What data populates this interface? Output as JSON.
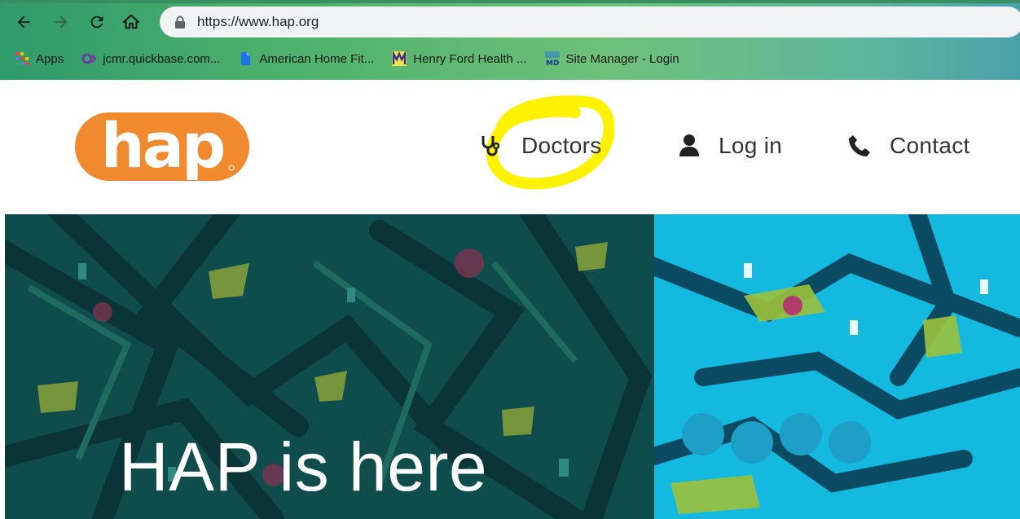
{
  "browser": {
    "url": "https://www.hap.org",
    "bookmarks": [
      {
        "label": "Apps",
        "icon": "apps-grid-icon"
      },
      {
        "label": "jcmr.quickbase.com...",
        "icon": "quickbase-icon"
      },
      {
        "label": "American Home Fit...",
        "icon": "bookmark-doc-icon"
      },
      {
        "label": "Henry Ford Health ...",
        "icon": "henry-ford-icon"
      },
      {
        "label": "Site Manager - Login",
        "icon": "md-icon"
      }
    ]
  },
  "site": {
    "logo_text": "hap",
    "nav": {
      "doctors": "Doctors",
      "login": "Log in",
      "contact": "Contact"
    },
    "hero_title": "HAP is here"
  },
  "colors": {
    "brand_orange": "#F18A2E",
    "highlight_yellow": "#FFF200",
    "hero_teal": "#0F4D4D",
    "hero_cyan": "#14B9E0"
  }
}
